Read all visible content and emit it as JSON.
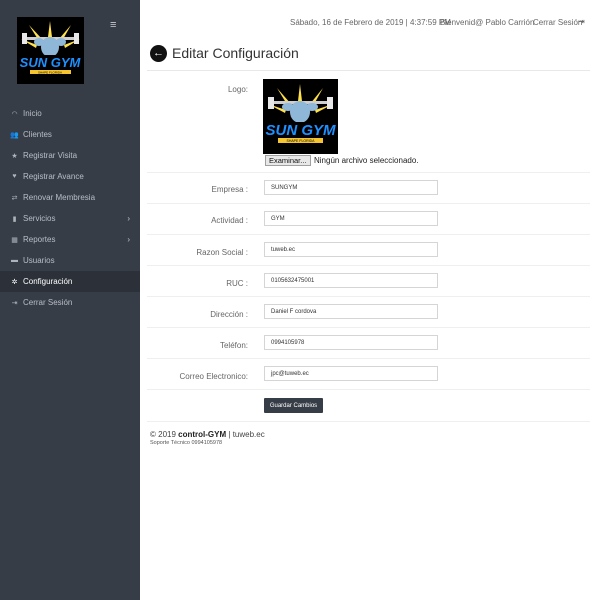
{
  "header": {
    "datetime": "Sábado, 16 de Febrero de 2019 | 4:37:59 PM",
    "welcome": "Bienvenid@ Pablo Carrión",
    "logout_label": "Cerrar Sesión"
  },
  "brand": {
    "logo_text_1": "SUN GYM",
    "logo_text_2": "SHAPE FLORIDA"
  },
  "sidebar": {
    "hamburger": "≡",
    "items": [
      {
        "label": "Inicio",
        "icon": "dashboard-icon",
        "glyph": "◠"
      },
      {
        "label": "Clientes",
        "icon": "users-icon",
        "glyph": "👥"
      },
      {
        "label": "Registrar Visita",
        "icon": "star-icon",
        "glyph": "★"
      },
      {
        "label": "Registrar Avance",
        "icon": "heart-icon",
        "glyph": "♥"
      },
      {
        "label": "Renovar Membresia",
        "icon": "link-icon",
        "glyph": "⇄"
      },
      {
        "label": "Servicios",
        "icon": "bolt-icon",
        "glyph": "▮"
      },
      {
        "label": "Reportes",
        "icon": "calendar-icon",
        "glyph": "▦"
      },
      {
        "label": "Usuarios",
        "icon": "folder-icon",
        "glyph": "▬"
      },
      {
        "label": "Configuración",
        "icon": "gear-icon",
        "glyph": "✲"
      },
      {
        "label": "Cerrar Sesión",
        "icon": "sign-out-icon",
        "glyph": "⇥"
      }
    ]
  },
  "page": {
    "title": "Editar Configuración"
  },
  "form": {
    "logo_label": "Logo:",
    "file_button": "Examinar...",
    "file_status": "Ningún archivo seleccionado.",
    "fields": [
      {
        "label": "Empresa :",
        "value": "SUNGYM"
      },
      {
        "label": "Actividad :",
        "value": "GYM"
      },
      {
        "label": "Razon Social :",
        "value": "tuweb.ec"
      },
      {
        "label": "RUC :",
        "value": "0105632475001"
      },
      {
        "label": "Dirección :",
        "value": "Daniel F cordova"
      },
      {
        "label": "Teléfon:",
        "value": "0994105978"
      },
      {
        "label": "Correo Electronico:",
        "value": "jpc@tuweb.ec"
      }
    ],
    "save_label": "Guardar Cambios"
  },
  "footer": {
    "copyright_prefix": "© 2019",
    "brand": "control-GYM",
    "suffix": "| tuweb.ec",
    "support": "Soporte Técnico 0994105978"
  }
}
